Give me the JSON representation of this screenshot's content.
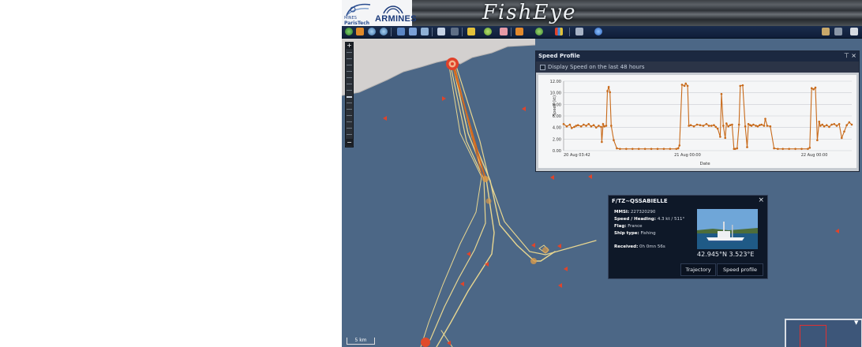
{
  "header": {
    "logo_mines": "MINES",
    "logo_tech": "ParisTech",
    "logo_armines": "ARMINES",
    "app_title": "FishEye"
  },
  "toolbar": {
    "icons": [
      "globe-icon",
      "pan-icon",
      "zoom-in-icon",
      "zoom-out-icon",
      "layers-icon",
      "grid-icon",
      "print-icon",
      "document-icon",
      "binoculars-icon",
      "pencil-icon",
      "measure-icon",
      "eraser-icon",
      "flag-icon",
      "route-icon",
      "chart-icon",
      "tools-icon",
      "help-icon",
      "search-icon",
      "settings-icon",
      "printer-icon"
    ]
  },
  "map": {
    "zoom_plus": "+",
    "zoom_minus": "−",
    "scale_label": "5 km"
  },
  "speed_panel": {
    "title": "Speed Profile",
    "pin": "⊤",
    "close": "×",
    "checkbox_label": "Display Speed on the last 48 hours",
    "chart_data": {
      "type": "line",
      "title": "",
      "xlabel": "Date",
      "ylabel": "Speed (kt)",
      "ylim": [
        0,
        12
      ],
      "y_ticks": [
        "0.00",
        "2.00",
        "4.00",
        "6.00",
        "8.00",
        "10.00",
        "12.00"
      ],
      "x_ticks": [
        "20 Aug 03:42",
        "21 Aug 00:00",
        "22 Aug 00:00"
      ],
      "color": "#c86a1a",
      "series": [
        {
          "x": [
            0.0,
            0.5,
            1.0,
            1.3,
            1.7,
            2.0,
            2.3,
            2.8,
            3.2,
            3.6,
            4.0,
            4.4,
            4.8,
            5.2,
            5.6,
            6.0,
            6.1,
            6.3,
            6.5,
            6.8,
            7.0,
            7.2,
            7.4,
            7.6,
            8.0,
            8.5,
            9.0,
            10.0,
            11.0,
            12.0,
            13.0,
            14.0,
            15.0,
            16.0,
            17.0,
            18.0,
            18.3,
            18.5,
            18.9,
            19.3,
            19.5,
            19.8,
            20.0,
            20.3,
            20.8,
            21.3,
            21.8,
            22.3,
            22.8,
            23.2,
            23.6,
            24.0,
            24.3,
            24.6,
            25.0,
            25.2,
            25.5,
            25.8,
            26.0,
            26.3,
            26.6,
            26.9,
            27.2,
            27.4,
            27.7,
            28.0,
            28.2,
            28.6,
            29.0,
            29.3,
            29.5,
            29.8,
            30.0,
            30.3,
            30.7,
            31.0,
            31.3,
            31.6,
            32.0,
            32.2,
            32.5,
            33.0,
            33.6,
            34.2,
            35.0,
            36.0,
            37.0,
            38.0,
            39.0,
            39.3,
            39.6,
            39.9,
            40.2,
            40.5,
            40.8,
            41.0,
            41.3,
            41.6,
            42.0,
            42.4,
            42.8,
            43.2,
            43.6,
            44.0,
            44.4,
            44.8,
            45.2,
            45.6,
            46.0
          ],
          "y": [
            4.6,
            4.2,
            4.5,
            3.9,
            4.1,
            4.3,
            4.4,
            4.2,
            4.5,
            4.3,
            4.6,
            4.2,
            4.4,
            4.0,
            4.3,
            4.1,
            1.5,
            4.6,
            4.2,
            4.3,
            10.3,
            11.0,
            10.1,
            4.3,
            1.8,
            0.4,
            0.3,
            0.3,
            0.3,
            0.3,
            0.3,
            0.3,
            0.3,
            0.3,
            0.3,
            0.3,
            0.4,
            0.9,
            11.4,
            11.2,
            11.6,
            11.2,
            4.3,
            4.4,
            4.2,
            4.5,
            4.4,
            4.3,
            4.6,
            4.3,
            4.3,
            4.4,
            4.1,
            3.8,
            2.4,
            9.8,
            4.3,
            2.2,
            4.7,
            4.2,
            4.4,
            4.5,
            0.3,
            0.3,
            0.4,
            4.5,
            11.2,
            11.3,
            4.2,
            0.6,
            4.6,
            4.4,
            4.3,
            4.5,
            4.3,
            4.2,
            4.4,
            4.5,
            4.3,
            5.5,
            4.3,
            4.2,
            0.4,
            0.3,
            0.3,
            0.3,
            0.3,
            0.3,
            0.3,
            0.5,
            10.8,
            10.6,
            10.9,
            1.8,
            5.0,
            4.3,
            4.5,
            4.2,
            4.4,
            4.1,
            4.5,
            4.6,
            4.3,
            4.6,
            2.2,
            3.3,
            4.4,
            4.9,
            4.5
          ]
        }
      ]
    }
  },
  "vessel": {
    "name": "F/TZ~QSSABIELLE",
    "close": "×",
    "mmsi_key": "MMSI:",
    "mmsi_val": "227320290",
    "speed_key": "Speed / Heading:",
    "speed_val": "4.3 kt / 511°",
    "flag_key": "Flag:",
    "flag_val": "France",
    "type_key": "Ship type:",
    "type_val": "Fishing",
    "received_key": "Received:",
    "received_val": "0h 0mn 56s",
    "coords": "42.945°N 3.523°E",
    "btn_trajectory": "Trajectory",
    "btn_speed_profile": "Speed profile"
  },
  "colors": {
    "sea": "#4c6786",
    "land": "#d3d0cf",
    "track_dark": "#d46a1e",
    "track_light": "#e9d89a",
    "marker": "#e0412a",
    "panel_dark": "#1b2840"
  }
}
